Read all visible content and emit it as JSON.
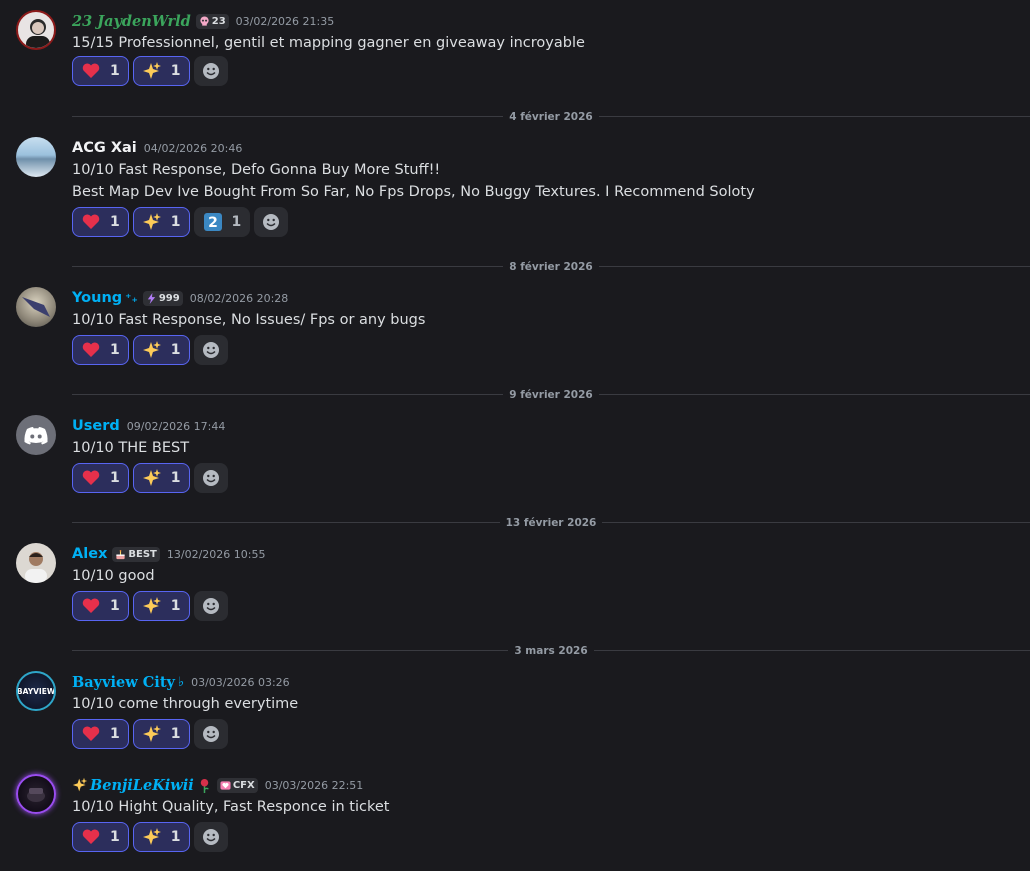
{
  "colors": {
    "green_name": "#3ba55c",
    "blue_name": "#00b0f4",
    "accent": "#5865f2"
  },
  "dividers": [
    "4 février 2026",
    "8 février 2026",
    "9 février 2026",
    "13 février 2026",
    "3 mars 2026"
  ],
  "messages": [
    {
      "username": "23 JaydenWrld",
      "tag": "23",
      "tag_icon": "skull-icon",
      "timestamp": "03/02/2026 21:35",
      "lines": [
        "15/15  Professionnel, gentil et mapping gagner en giveaway incroyable"
      ],
      "reactions": [
        {
          "emoji": "heart",
          "count": "1"
        },
        {
          "emoji": "sparkles",
          "count": "1"
        }
      ]
    },
    {
      "username": "ACG Xai",
      "timestamp": "04/02/2026 20:46",
      "lines": [
        "10/10 Fast Response, Defo Gonna Buy More Stuff!!",
        "Best Map Dev Ive Bought From So Far, No Fps Drops, No Buggy Textures. I Recommend Soloty"
      ],
      "reactions": [
        {
          "emoji": "heart",
          "count": "1"
        },
        {
          "emoji": "sparkles",
          "count": "1"
        },
        {
          "emoji": "keycap-2",
          "count": "1"
        }
      ]
    },
    {
      "username": "Young",
      "name_suffix": "⁺₊",
      "tag": "999",
      "tag_icon": "lightning-icon",
      "timestamp": "08/02/2026 20:28",
      "lines": [
        "10/10 Fast Response, No Issues/ Fps or any bugs"
      ],
      "reactions": [
        {
          "emoji": "heart",
          "count": "1"
        },
        {
          "emoji": "sparkles",
          "count": "1"
        }
      ]
    },
    {
      "username": "Userd",
      "timestamp": "09/02/2026 17:44",
      "lines": [
        "10/10 THE BEST"
      ],
      "reactions": [
        {
          "emoji": "heart",
          "count": "1"
        },
        {
          "emoji": "sparkles",
          "count": "1"
        }
      ]
    },
    {
      "username": "Alex",
      "tag": "BEST",
      "tag_icon": "cake-icon",
      "timestamp": "13/02/2026 10:55",
      "lines": [
        "10/10 good"
      ],
      "reactions": [
        {
          "emoji": "heart",
          "count": "1"
        },
        {
          "emoji": "sparkles",
          "count": "1"
        }
      ]
    },
    {
      "username": "Bayview City",
      "name_suffix": "♭",
      "timestamp": "03/03/2026 03:26",
      "lines": [
        "10/10 come through everytime"
      ],
      "reactions": [
        {
          "emoji": "heart",
          "count": "1"
        },
        {
          "emoji": "sparkles",
          "count": "1"
        }
      ],
      "avatar_text": "BAYVIEW"
    },
    {
      "username": "BenjiLeKiwii",
      "tag": "CFX",
      "tag_icon": "heart-badge-icon",
      "timestamp": "03/03/2026 22:51",
      "lines": [
        "10/10 Hight Quality, Fast Responce in ticket"
      ],
      "reactions": [
        {
          "emoji": "heart",
          "count": "1"
        },
        {
          "emoji": "sparkles",
          "count": "1"
        }
      ]
    }
  ]
}
